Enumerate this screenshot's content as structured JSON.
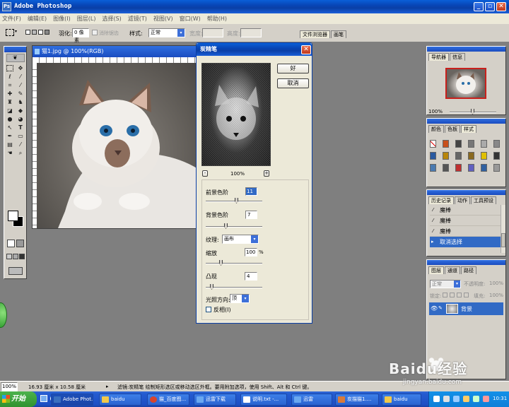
{
  "app": {
    "title": "Adobe Photoshop"
  },
  "menu": [
    "文件(F)",
    "编辑(E)",
    "图像(I)",
    "图层(L)",
    "选择(S)",
    "滤镜(T)",
    "视图(V)",
    "窗口(W)",
    "帮助(H)"
  ],
  "options": {
    "feather_label": "羽化:",
    "feather_value": "0 像素",
    "antialias_label": "消除锯齿",
    "style_label": "样式:",
    "style_value": "正常",
    "width_label": "宽度:",
    "height_label": "高度:"
  },
  "palette_tabs": [
    "文件浏览器",
    "画笔"
  ],
  "document": {
    "title": "猫1.jpg @ 100%(RGB)"
  },
  "filter_dialog": {
    "title": "炭精笔",
    "ok_label": "好",
    "cancel_label": "取消",
    "zoom_value": "100%",
    "fg_label": "前景色阶",
    "fg_value": "11",
    "bg_label": "背景色阶",
    "bg_value": "7",
    "texture_label": "纹理:",
    "texture_value": "画布",
    "scale_label": "缩放",
    "scale_value": "100",
    "scale_unit": "%",
    "relief_label": "凸现",
    "relief_value": "4",
    "light_label": "光照方向:",
    "light_value": "顶",
    "invert_label": "反相(I)",
    "fg_level": 0.55,
    "bg_level": 0.35,
    "scale_level": 0.25,
    "relief_level": 0.08
  },
  "navigator": {
    "tabs": [
      "导航器",
      "信息"
    ],
    "zoom_value": "100%"
  },
  "color_panel": {
    "tabs": [
      "颜色",
      "色板",
      "样式"
    ]
  },
  "history": {
    "tabs": [
      "历史记录",
      "动作",
      "工具预设"
    ],
    "items": [
      "魔棒",
      "魔棒",
      "魔棒",
      "取消选择"
    ]
  },
  "layers": {
    "tabs": [
      "图层",
      "通道",
      "路径"
    ],
    "blend_value": "正常",
    "opacity_label": "不透明度:",
    "opacity_value": "100%",
    "lock_label": "锁定:",
    "fill_label": "填充:",
    "fill_value": "100%",
    "layer_name": "背景"
  },
  "status": {
    "zoom": "100%",
    "doc_size": "16.93 厘米 x 10.58 厘米",
    "message": "滤镜:炭精笔  绘制矩形选区或移动选区外框。要用附加选项，使用 Shift、Alt 和 Ctrl 键。"
  },
  "taskbar": {
    "start_label": "开始",
    "tasks": [
      "Adobe Phot...",
      "baidu",
      "猫_百度图...",
      "迅雷下载",
      "说明.txt -...",
      "迅雷",
      "炭描猫1....",
      "baidu"
    ],
    "clock": "10:31"
  },
  "watermark": {
    "text": "Baidu经验",
    "url": "jingyan.baidu.com"
  }
}
